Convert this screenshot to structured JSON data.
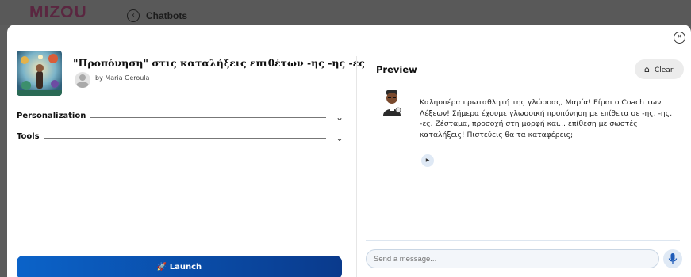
{
  "header": {
    "logo": "MIZOU",
    "back_icon": "arrow-left-circle-icon",
    "back_label": "Chatbots"
  },
  "modal": {
    "close_icon": "close-circle-icon",
    "close_glyph": "×"
  },
  "chatbot": {
    "title": "\"Προπόνηση\" στις καταλήξεις επιθέτων -ης -ης -ες",
    "author": "by Maria Geroula"
  },
  "sections": [
    {
      "label": "Personalization",
      "icon": "chevron-down-icon"
    },
    {
      "label": "Tools",
      "icon": "chevron-down-icon"
    }
  ],
  "launch": {
    "label": "🚀 Launch",
    "icon": "rocket-icon"
  },
  "preview": {
    "label": "Preview",
    "clear_label": "Clear",
    "clear_icon": "broom-icon",
    "bot_avatar_icon": "coach-avatar-icon",
    "message": "Καλησπέρα πρωταθλητή της γλώσσας, Μαρία! Είμαι ο Coach των Λέξεων! Σήμερα έχουμε γλωσσική προπόνηση με επίθετα σε -ης, -ης, -ες. Ζέσταμα, προσοχή στη μορφή και... επίθεση με σωστές καταλήξεις! Πιστεύεις θα τα καταφέρεις;",
    "play_icon": "play-icon",
    "input_placeholder": "Send a message...",
    "mic_icon": "microphone-icon"
  },
  "colors": {
    "launch_start": "#0b63c9",
    "launch_end": "#0a3a8c",
    "logo": "#5a2640"
  }
}
